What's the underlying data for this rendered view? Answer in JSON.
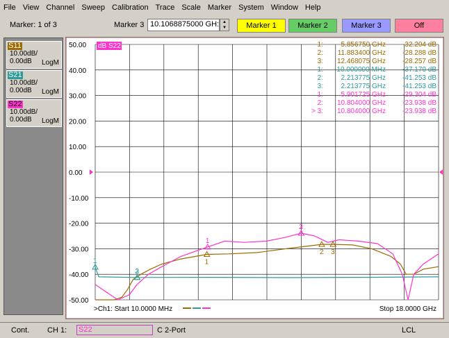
{
  "menu": [
    "File",
    "View",
    "Channel",
    "Sweep",
    "Calibration",
    "Trace",
    "Scale",
    "Marker",
    "System",
    "Window",
    "Help"
  ],
  "toolbar": {
    "marker_count": "Marker: 1 of 3",
    "marker_label": "Marker 3",
    "marker_value": "10.1068875000 GH:",
    "buttons": [
      {
        "label": "Marker 1",
        "color": "#ffff00"
      },
      {
        "label": "Marker 2",
        "color": "#66cc66"
      },
      {
        "label": "Marker 3",
        "color": "#9999ff"
      },
      {
        "label": "Off",
        "color": "#ff7f9f"
      }
    ]
  },
  "traces": [
    {
      "name": "S11",
      "scale": "10.00dB/",
      "ref": "0.00dB",
      "format": "LogM",
      "color": "#9c6a00",
      "text_color": "#ffffff"
    },
    {
      "name": "S21",
      "scale": "10.00dB/",
      "ref": "0.00dB",
      "format": "LogM",
      "color": "#2a9a9a",
      "text_color": "#ffffff"
    },
    {
      "name": "S22",
      "scale": "10.00dB/",
      "ref": "0.00dB",
      "format": "LogM",
      "color": "#ff33cc",
      "text_color": "#000000"
    }
  ],
  "active_trace_label": "dB S22",
  "y_ticks": [
    "50.00",
    "40.00",
    "30.00",
    "20.00",
    "10.00",
    "0.00",
    "-10.00",
    "-20.00",
    "-30.00",
    "-40.00",
    "-50.00"
  ],
  "marker_table": [
    {
      "id": "1:",
      "freq": "5.856750 GHz",
      "val": "-32.204 dB",
      "color": "#9c6a00"
    },
    {
      "id": "2:",
      "freq": "11.883400 GHz",
      "val": "-28.288 dB",
      "color": "#9c6a00"
    },
    {
      "id": "3:",
      "freq": "12.468075 GHz",
      "val": "-28.257 dB",
      "color": "#9c6a00"
    },
    {
      "id": "1:",
      "freq": "10.000000 MHz",
      "val": "-37.170 dB",
      "color": "#2a9a9a"
    },
    {
      "id": "2:",
      "freq": "2.213775 GHz",
      "val": "-41.253 dB",
      "color": "#2a9a9a"
    },
    {
      "id": "3:",
      "freq": "2.213775 GHz",
      "val": "-41.253 dB",
      "color": "#2a9a9a"
    },
    {
      "id": "1:",
      "freq": "5.901725 GHz",
      "val": "-29.304 dB",
      "color": "#ff33cc"
    },
    {
      "id": "2:",
      "freq": "10.804000 GHz",
      "val": "-23.938 dB",
      "color": "#ff33cc"
    },
    {
      "id": "> 3:",
      "freq": "10.804000 GHz",
      "val": "-23.938 dB",
      "color": "#ff33cc"
    }
  ],
  "footer": {
    "start": ">Ch1: Start  10.0000 MHz",
    "stop": "Stop  18.0000 GHz"
  },
  "status": {
    "mode": "Cont.",
    "channel": "CH 1:",
    "trace": "S22",
    "cal": "C  2-Port",
    "remote": "LCL"
  },
  "chart_data": {
    "type": "line",
    "xlim": [
      0.01,
      18.0
    ],
    "ylim": [
      -50,
      50
    ],
    "grid": true,
    "series": [
      {
        "name": "S11",
        "color": "#9c6a00",
        "points": [
          [
            0.01,
            -50
          ],
          [
            1.0,
            -50
          ],
          [
            1.4,
            -49
          ],
          [
            1.7,
            -46
          ],
          [
            2.0,
            -42
          ],
          [
            2.4,
            -40
          ],
          [
            2.9,
            -38
          ],
          [
            3.5,
            -36
          ],
          [
            4.5,
            -34
          ],
          [
            5.86,
            -32.2
          ],
          [
            7,
            -32
          ],
          [
            8.5,
            -31.5
          ],
          [
            10,
            -30
          ],
          [
            11.88,
            -28.3
          ],
          [
            12.47,
            -28.3
          ],
          [
            13.5,
            -28.5
          ],
          [
            14.5,
            -30
          ],
          [
            15.5,
            -33
          ],
          [
            16,
            -36
          ],
          [
            16.3,
            -40
          ],
          [
            16.7,
            -40
          ],
          [
            17.2,
            -38
          ],
          [
            18,
            -37
          ]
        ]
      },
      {
        "name": "S21",
        "color": "#2a9a9a",
        "points": [
          [
            0.01,
            -37.2
          ],
          [
            0.2,
            -41
          ],
          [
            2.21,
            -41.25
          ],
          [
            6,
            -41.2
          ],
          [
            10,
            -41.3
          ],
          [
            14,
            -41.2
          ],
          [
            18,
            -41
          ]
        ]
      },
      {
        "name": "S22",
        "color": "#ff33cc",
        "points": [
          [
            0.01,
            -44
          ],
          [
            0.6,
            -47
          ],
          [
            1.2,
            -50
          ],
          [
            1.8,
            -48
          ],
          [
            2.2,
            -44
          ],
          [
            2.8,
            -40
          ],
          [
            3.5,
            -37
          ],
          [
            4.5,
            -33
          ],
          [
            5.9,
            -29.3
          ],
          [
            6.8,
            -27
          ],
          [
            7.8,
            -27.5
          ],
          [
            9,
            -27
          ],
          [
            10,
            -25.5
          ],
          [
            10.8,
            -23.9
          ],
          [
            11.5,
            -25
          ],
          [
            12.2,
            -27.5
          ],
          [
            12.8,
            -26.5
          ],
          [
            13.8,
            -27
          ],
          [
            14.8,
            -28
          ],
          [
            15.6,
            -32
          ],
          [
            16.1,
            -40
          ],
          [
            16.4,
            -50
          ],
          [
            16.7,
            -40
          ],
          [
            17.2,
            -36
          ],
          [
            18,
            -32
          ]
        ]
      }
    ],
    "markers": [
      {
        "trace": "S11",
        "label": "1",
        "x": 5.86,
        "y": -32.2,
        "color": "#9c6a00"
      },
      {
        "trace": "S11",
        "label": "2",
        "x": 11.88,
        "y": -28.3,
        "color": "#9c6a00"
      },
      {
        "trace": "S11",
        "label": "3",
        "x": 12.47,
        "y": -28.3,
        "color": "#9c6a00"
      },
      {
        "trace": "S21",
        "label": "1",
        "x": 0.01,
        "y": -37.2,
        "color": "#2a9a9a"
      },
      {
        "trace": "S21",
        "label": "2",
        "x": 2.21,
        "y": -41.25,
        "color": "#2a9a9a"
      },
      {
        "trace": "S21",
        "label": "3",
        "x": 2.21,
        "y": -41.25,
        "color": "#2a9a9a"
      },
      {
        "trace": "S22",
        "label": "1",
        "x": 5.9,
        "y": -29.3,
        "color": "#ff33cc"
      },
      {
        "trace": "S22",
        "label": "2",
        "x": 10.8,
        "y": -23.9,
        "color": "#ff33cc"
      },
      {
        "trace": "S22",
        "label": "3",
        "x": 10.8,
        "y": -23.9,
        "color": "#ff33cc"
      }
    ]
  }
}
